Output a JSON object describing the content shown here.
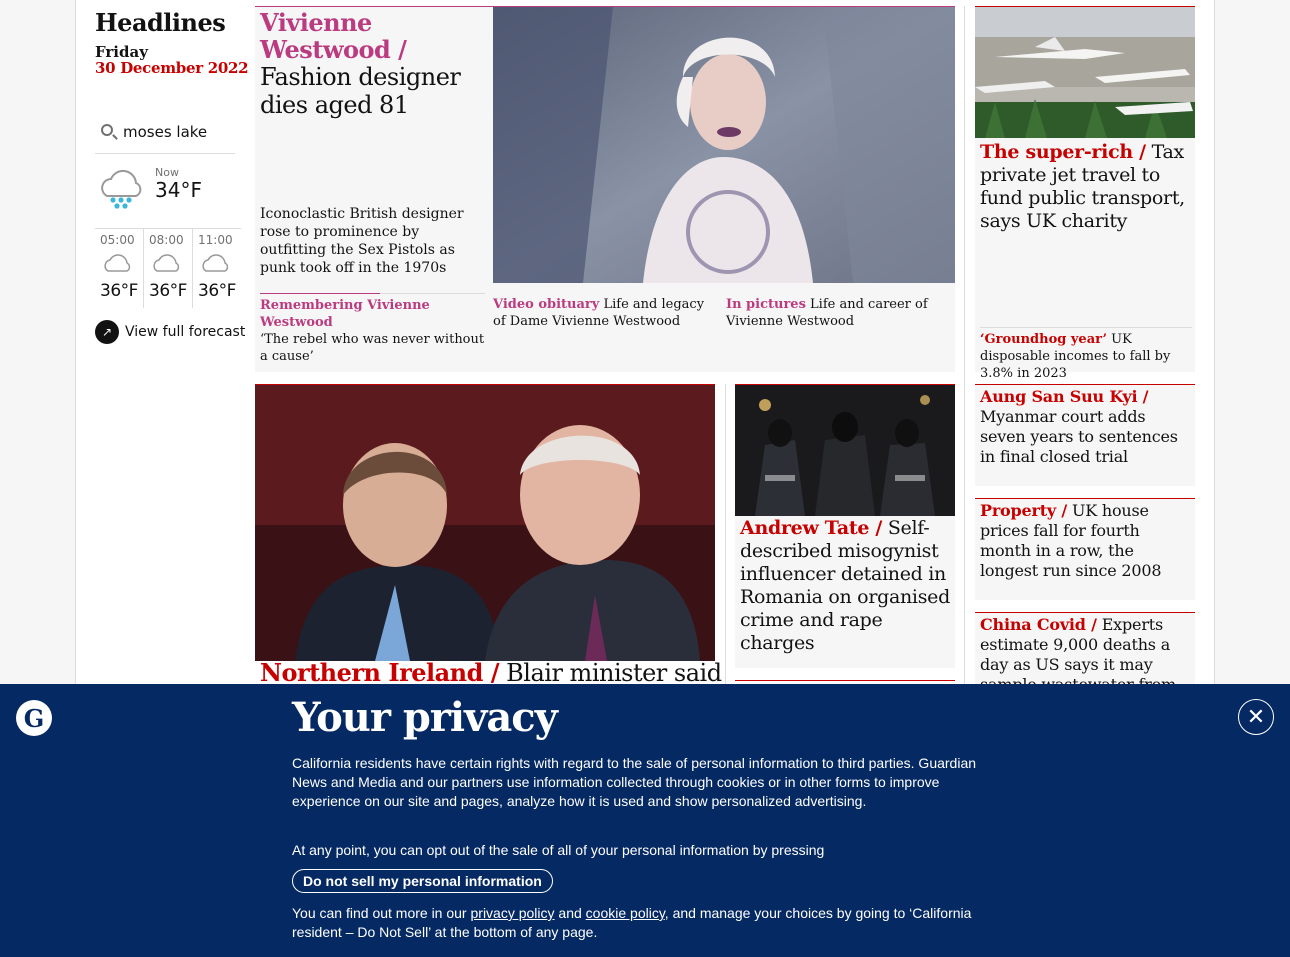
{
  "sidebar": {
    "title": "Headlines",
    "day": "Friday",
    "date": "30 December 2022",
    "search_value": "moses lake",
    "weather": {
      "now_label": "Now",
      "now_temp": "34°F",
      "now_icon": "sleet-cloud-icon",
      "forecast": [
        {
          "time": "05:00",
          "temp": "36°F",
          "icon": "cloud-icon"
        },
        {
          "time": "08:00",
          "temp": "36°F",
          "icon": "cloud-icon"
        },
        {
          "time": "11:00",
          "temp": "36°F",
          "icon": "cloud-icon"
        }
      ],
      "full_forecast_label": "View full forecast"
    }
  },
  "cards": {
    "westwood": {
      "kicker": "Vivienne Westwood /",
      "title": "Fashion designer dies aged 81",
      "standfirst": "Iconoclastic British designer rose to prominence by outfitting the Sex Pistols as punk took off in the 1970s",
      "subs": [
        {
          "kicker": "Remembering Vivienne Westwood",
          "text": "‘The rebel who was never without a cause’"
        },
        {
          "kicker": "Video obituary",
          "text": "Life and legacy of Dame Vivienne Westwood"
        },
        {
          "kicker": "In pictures",
          "text": "Life and career of Vivienne Westwood"
        }
      ]
    },
    "jet": {
      "kicker": "The super-rich /",
      "title": "Tax private jet travel to fund public transport, says UK charity",
      "sub_kicker": "‘Groundhog year’",
      "sub_text": "UK disposable incomes to fall by 3.8% in 2023"
    },
    "blair": {
      "kicker": "Northern Ireland /",
      "title": "Blair minister said"
    },
    "tate": {
      "kicker": "Andrew Tate /",
      "title": "Self-described misogynist influencer detained in Romania on organised crime and rape charges"
    },
    "small": [
      {
        "kicker": "Aung San Suu Kyi /",
        "title": "Myanmar court adds seven years to sentences in final closed trial"
      },
      {
        "kicker": "Property /",
        "title": "UK house prices fall for fourth month in a row, the longest run since 2008"
      },
      {
        "kicker": "China Covid /",
        "title": "Experts estimate 9,000 deaths a day as US says it may sample wastewater from"
      }
    ]
  },
  "privacy": {
    "logo": "G",
    "title": "Your privacy",
    "p1": "California residents have certain rights with regard to the sale of personal information to third parties. Guardian News and Media and our partners use information collected through cookies or in other forms to improve experience on our site and pages, analyze how it is used and show personalized advertising.",
    "p2": "At any point, you can opt out of the sale of all of your personal information by pressing",
    "button": "Do not sell my personal information",
    "p3_a": "You can find out more in our",
    "privacy_link": "privacy policy",
    "p3_and": "and",
    "cookie_link": "cookie policy",
    "p3_b": ", and manage your choices by going to ‘California resident – Do Not Sell’ at the bottom of any page.",
    "close": "✕"
  },
  "colors": {
    "news_red": "#c70000",
    "lifestyle_pink": "#bb3b80",
    "brand_blue": "#052962"
  }
}
